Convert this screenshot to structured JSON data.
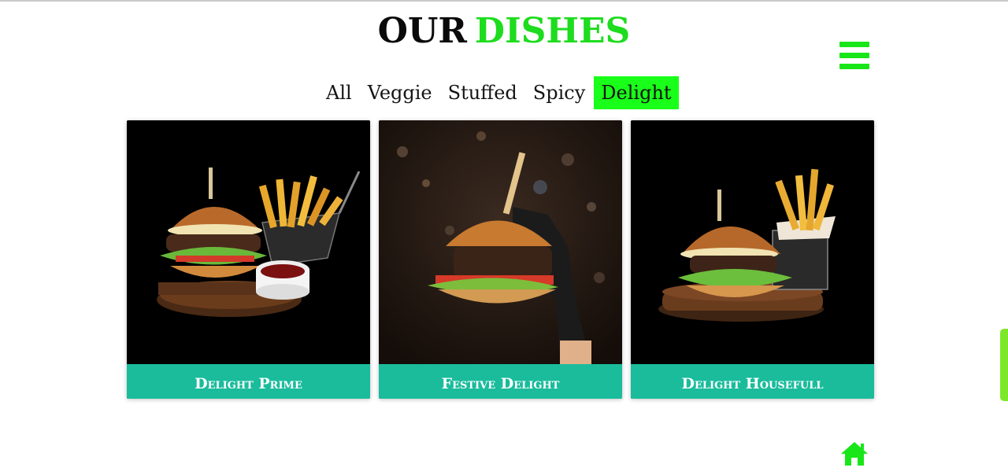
{
  "header": {
    "title_part1": "OUR",
    "title_part2": "DISHES"
  },
  "icons": {
    "menu": "hamburger-menu-icon",
    "home": "home-icon"
  },
  "filters": [
    {
      "label": "All",
      "active": false
    },
    {
      "label": "Veggie",
      "active": false
    },
    {
      "label": "Stuffed",
      "active": false
    },
    {
      "label": "Spicy",
      "active": false
    },
    {
      "label": "Delight",
      "active": true
    }
  ],
  "dishes": [
    {
      "name": "Delight Prime"
    },
    {
      "name": "Festive Delight"
    },
    {
      "name": "Delight Housefull"
    }
  ],
  "colors": {
    "accent_green": "#19e619",
    "active_filter_bg": "#19ff19",
    "caption_teal": "#1abc9c",
    "scrollbar": "#7de82a"
  }
}
